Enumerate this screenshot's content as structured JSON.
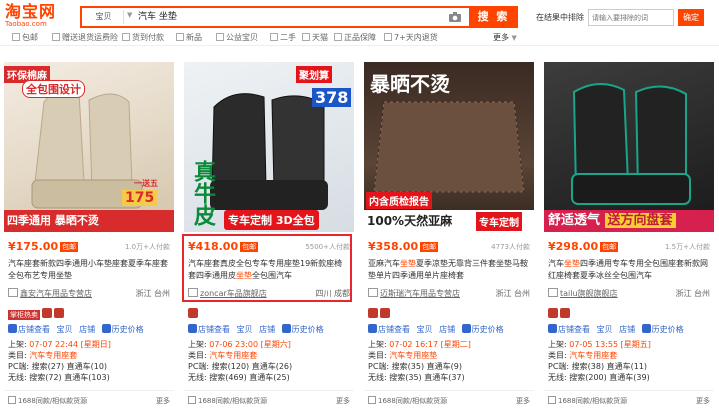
{
  "logo": {
    "main": "淘宝网",
    "sub": "Taobao.com"
  },
  "search": {
    "category": "宝贝",
    "query": "汽车 坐垫",
    "button": "搜 索"
  },
  "exclude": {
    "label": "在结果中排除",
    "placeholder": "请输入要排除的词",
    "button": "确定"
  },
  "filters": [
    "包邮",
    "赠送退货运费险",
    "货到付款",
    "新品",
    "公益宝贝",
    "二手",
    "天猫",
    "正品保障",
    "7+天内退货"
  ],
  "more_filters": "更多",
  "colors": {
    "accent": "#ff4400",
    "link": "#3366cc",
    "highlight": "#e8262c"
  },
  "cards": [
    {
      "img_text": [
        "环保棉麻",
        "全包围设计",
        "四季通用 暴晒不烫",
        "175",
        "一送五"
      ],
      "price": "¥175.00",
      "tag": "包邮",
      "sales": "1.0万+人付款",
      "title_a": "汽车座套新款四季通用小车垫座套夏季车座套全包布艺专用坐垫",
      "title_hl": "",
      "title_b": "",
      "shop": "鑫安汽车用品专营店",
      "location": "浙江 台州",
      "badges": [
        "掌柜热卖"
      ],
      "links": [
        "店铺查看",
        "宝贝",
        "店铺",
        "历史价格"
      ],
      "info": [
        {
          "k": "上架:",
          "v": "07-07 22:44 [星期日]"
        },
        {
          "k": "类目:",
          "v": "汽车专用座套"
        },
        {
          "k": "PC端:",
          "v": "搜索(27) 直通车(10)"
        },
        {
          "k": "无线:",
          "v": "搜索(72) 直通车(103)"
        }
      ],
      "foot_left": "1688同款/相似款货源",
      "foot_right": "更多"
    },
    {
      "img_text": [
        "聚划算",
        "378",
        "真牛皮",
        "专车定制 3D全包"
      ],
      "price": "¥418.00",
      "tag": "包邮",
      "sales": "5500+人付款",
      "title_a": "汽车座套真皮全包专车专用座垫19新款座椅套四季通用皮",
      "title_hl": "坐垫",
      "title_b": "全包围汽车",
      "shop": "zoncar车品旗舰店",
      "location": "四川 成都",
      "badges": [],
      "links": [
        "店铺查看",
        "宝贝",
        "店铺",
        "历史价格"
      ],
      "info": [
        {
          "k": "上架:",
          "v": "07-06 23:00 [星期六]"
        },
        {
          "k": "类目:",
          "v": "汽车专用座套"
        },
        {
          "k": "PC端:",
          "v": "搜索(120) 直通车(26)"
        },
        {
          "k": "无线:",
          "v": "搜索(469) 直通车(25)"
        }
      ],
      "foot_left": "1688同款/相似款货源",
      "foot_right": "更多"
    },
    {
      "img_text": [
        "暴晒不烫",
        "内含质检报告",
        "100%天然亚麻",
        "专车定制"
      ],
      "price": "¥358.00",
      "tag": "包邮",
      "sales": "4773人付款",
      "title_a": "亚麻汽车",
      "title_hl": "坐垫",
      "title_b": "夏季凉垫无靠背三件套坐垫马鞍垫单片四季通用单片座椅套",
      "shop": "迈斯瑞汽车用品专营店",
      "location": "浙江 台州",
      "badges": [],
      "links": [
        "店铺查看",
        "宝贝",
        "店铺",
        "历史价格"
      ],
      "info": [
        {
          "k": "上架:",
          "v": "07-02 16:17 [星期二]"
        },
        {
          "k": "类目:",
          "v": "汽车专用座垫"
        },
        {
          "k": "PC端:",
          "v": "搜索(35) 直通车(9)"
        },
        {
          "k": "无线:",
          "v": "搜索(35) 直通车(37)"
        }
      ],
      "foot_left": "1688同款/相似款货源",
      "foot_right": "更多"
    },
    {
      "img_text": [
        "舒适透气",
        "送方向盘套"
      ],
      "price": "¥298.00",
      "tag": "包邮",
      "sales": "1.5万+人付款",
      "title_a": "汽车",
      "title_hl": "坐垫",
      "title_b": "四季通用专车专用全包围座套新款网红座椅套夏季冰丝全包围汽车",
      "shop": "tailu旗舰旗舰店",
      "location": "浙江 台州",
      "badges": [],
      "links": [
        "店铺查看",
        "宝贝",
        "店铺",
        "历史价格"
      ],
      "info": [
        {
          "k": "上架:",
          "v": "07-05 13:55 [星期五]"
        },
        {
          "k": "类目:",
          "v": "汽车专用座套"
        },
        {
          "k": "PC端:",
          "v": "搜索(38) 直通车(11)"
        },
        {
          "k": "无线:",
          "v": "搜索(200) 直通车(39)"
        }
      ],
      "foot_left": "1688同款/相似款货源",
      "foot_right": "更多"
    }
  ]
}
